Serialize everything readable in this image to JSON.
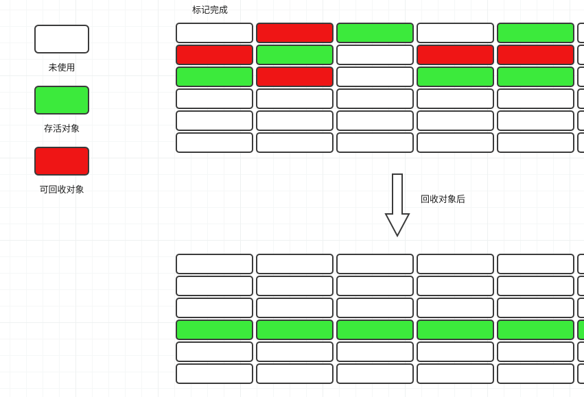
{
  "legend": {
    "unused": {
      "label": "未使用",
      "color": "#ffffff"
    },
    "alive": {
      "label": "存活对象",
      "color": "#3cea3c"
    },
    "recyclable": {
      "label": "可回收对象",
      "color": "#ef1515"
    }
  },
  "captions": {
    "mark_done": "标记完成",
    "after_collect": "回收对象后"
  },
  "cell": {
    "base_width": 113,
    "last_width": 20,
    "height": 30,
    "radius": 5
  },
  "before_grid": [
    [
      "w",
      "r",
      "g",
      "w",
      "g",
      "w"
    ],
    [
      "r",
      "g",
      "w",
      "r",
      "r",
      "w"
    ],
    [
      "g",
      "r",
      "w",
      "g",
      "g",
      "w"
    ],
    [
      "w",
      "w",
      "w",
      "w",
      "w",
      "w"
    ],
    [
      "w",
      "w",
      "w",
      "w",
      "w",
      "w"
    ],
    [
      "w",
      "w",
      "w",
      "w",
      "w",
      "w"
    ]
  ],
  "after_grid": [
    [
      "w",
      "w",
      "w",
      "w",
      "w",
      "w"
    ],
    [
      "w",
      "w",
      "w",
      "w",
      "w",
      "w"
    ],
    [
      "w",
      "w",
      "w",
      "w",
      "w",
      "w"
    ],
    [
      "g",
      "g",
      "g",
      "g",
      "g",
      "g"
    ],
    [
      "w",
      "w",
      "w",
      "w",
      "w",
      "w"
    ],
    [
      "w",
      "w",
      "w",
      "w",
      "w",
      "w"
    ]
  ]
}
